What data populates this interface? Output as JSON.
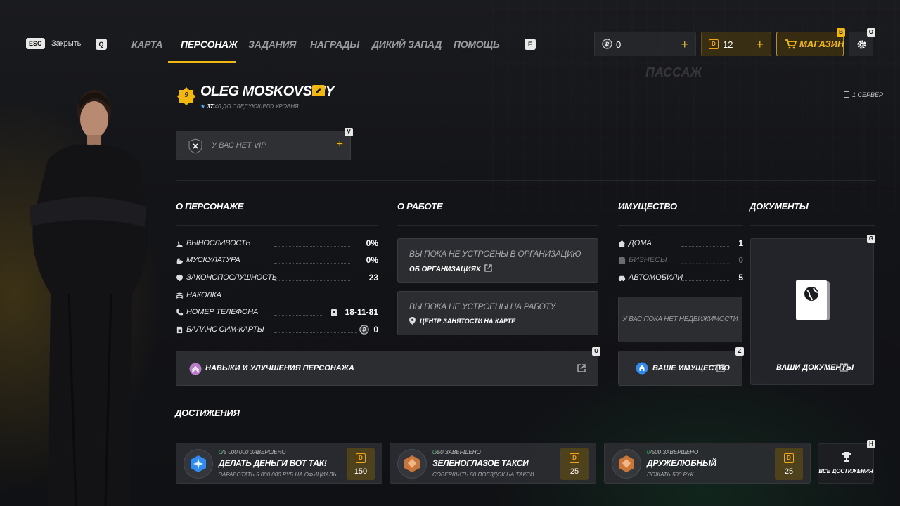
{
  "header": {
    "close_key": "ESC",
    "close_label": "Закрыть",
    "prev_key": "Q",
    "next_key": "E",
    "tabs": [
      {
        "label": "КАРТА"
      },
      {
        "label": "ПЕРСОНАЖ"
      },
      {
        "label": "ЗАДАНИЯ"
      },
      {
        "label": "НАГРАДЫ"
      },
      {
        "label": "ДИКИЙ ЗАПАД"
      },
      {
        "label": "ПОМОЩЬ"
      }
    ],
    "active_tab": "ПЕРСОНАЖ",
    "currency_rub": "0",
    "currency_donate": "12",
    "shop_label": "МАГАЗИН",
    "shop_key": "B",
    "settings_key": "O"
  },
  "player": {
    "level": "9",
    "name": "OLEG MOSKOVSKIY",
    "xp_current": "37",
    "xp_max": "/40",
    "xp_label": "ДО СЛЕДУЮЩЕГО УРОВНЯ",
    "server": "1 СЕРВЕР"
  },
  "vip": {
    "label": "У ВАС НЕТ VIP",
    "key": "V"
  },
  "about": {
    "title": "О ПЕРСОНАЖЕ",
    "stats": [
      {
        "label": "ВЫНОСЛИВОСТЬ",
        "value": "0%",
        "icon": "run-icon"
      },
      {
        "label": "МУСКУЛАТУРА",
        "value": "0%",
        "icon": "muscle-icon"
      },
      {
        "label": "ЗАКОНОПОСЛУШНОСТЬ",
        "value": "23",
        "icon": "law-icon"
      },
      {
        "label": "НАКОЛКА",
        "value": "",
        "icon": "tattoo-icon"
      },
      {
        "label": "НОМЕР ТЕЛЕФОНА",
        "value": "18-11-81",
        "icon": "phone-icon"
      },
      {
        "label": "БАЛАНС СИМ-КАРТЫ",
        "value": "0",
        "icon": "sim-icon"
      }
    ],
    "skills_label": "НАВЫКИ И УЛУЧШЕНИЯ ПЕРСОНАЖА",
    "skills_key": "U"
  },
  "work": {
    "title": "О РАБОТЕ",
    "org_text": "ВЫ ПОКА НЕ УСТРОЕНЫ В ОРГАНИЗАЦИЮ",
    "org_link": "ОБ ОРГАНИЗАЦИЯХ",
    "job_text": "ВЫ ПОКА НЕ УСТРОЕНЫ НА РАБОТУ",
    "job_link": "ЦЕНТР ЗАНЯТОСТИ НА КАРТЕ"
  },
  "property": {
    "title": "ИМУЩЕСТВО",
    "items": [
      {
        "label": "ДОМА",
        "value": "1",
        "icon": "house-icon"
      },
      {
        "label": "БИЗНЕСЫ",
        "value": "0",
        "icon": "business-icon"
      },
      {
        "label": "АВТОМОБИЛИ",
        "value": "5",
        "icon": "car-icon"
      }
    ],
    "empty_text": "У ВАС ПОКА НЕТ НЕДВИЖИМОСТИ",
    "your_property_label": "ВАШЕ ИМУЩЕСТВО",
    "key": "Z"
  },
  "documents": {
    "title": "ДОКУМЕНТЫ",
    "label": "ВАШИ ДОКУМЕНТЫ",
    "key": "G"
  },
  "achievements": {
    "title": "ДОСТИЖЕНИЯ",
    "all_label": "ВСЕ ДОСТИЖЕНИЯ",
    "key": "H",
    "items": [
      {
        "done": "0",
        "total": "/5 000 000 ЗАВЕРШЕНО",
        "title": "ДЕЛАТЬ ДЕНЬГИ ВОТ ТАК!",
        "desc": "ЗАРАБОТАТЬ 5 000 000 РУБ НА ОФИЦИАЛЬНЫХ РАБОТАХ",
        "reward": "150",
        "medal": "diamond-medal-icon"
      },
      {
        "done": "0",
        "total": "/50 ЗАВЕРШЕНО",
        "title": "ЗЕЛЕНОГЛАЗОЕ ТАКСИ",
        "desc": "СОВЕРШИТЬ 50 ПОЕЗДОК НА ТАКСИ",
        "reward": "25",
        "medal": "bronze-medal-icon"
      },
      {
        "done": "0",
        "total": "/500 ЗАВЕРШЕНО",
        "title": "ДРУЖЕЛЮБНЫЙ",
        "desc": "ПОЖАТЬ 500 РУК",
        "reward": "25",
        "medal": "bronze-medal-icon"
      }
    ]
  },
  "colors": {
    "accent": "#f2b80f",
    "green": "#3fd07a",
    "blue": "#2f8bef",
    "bronze": "#c9763a"
  }
}
